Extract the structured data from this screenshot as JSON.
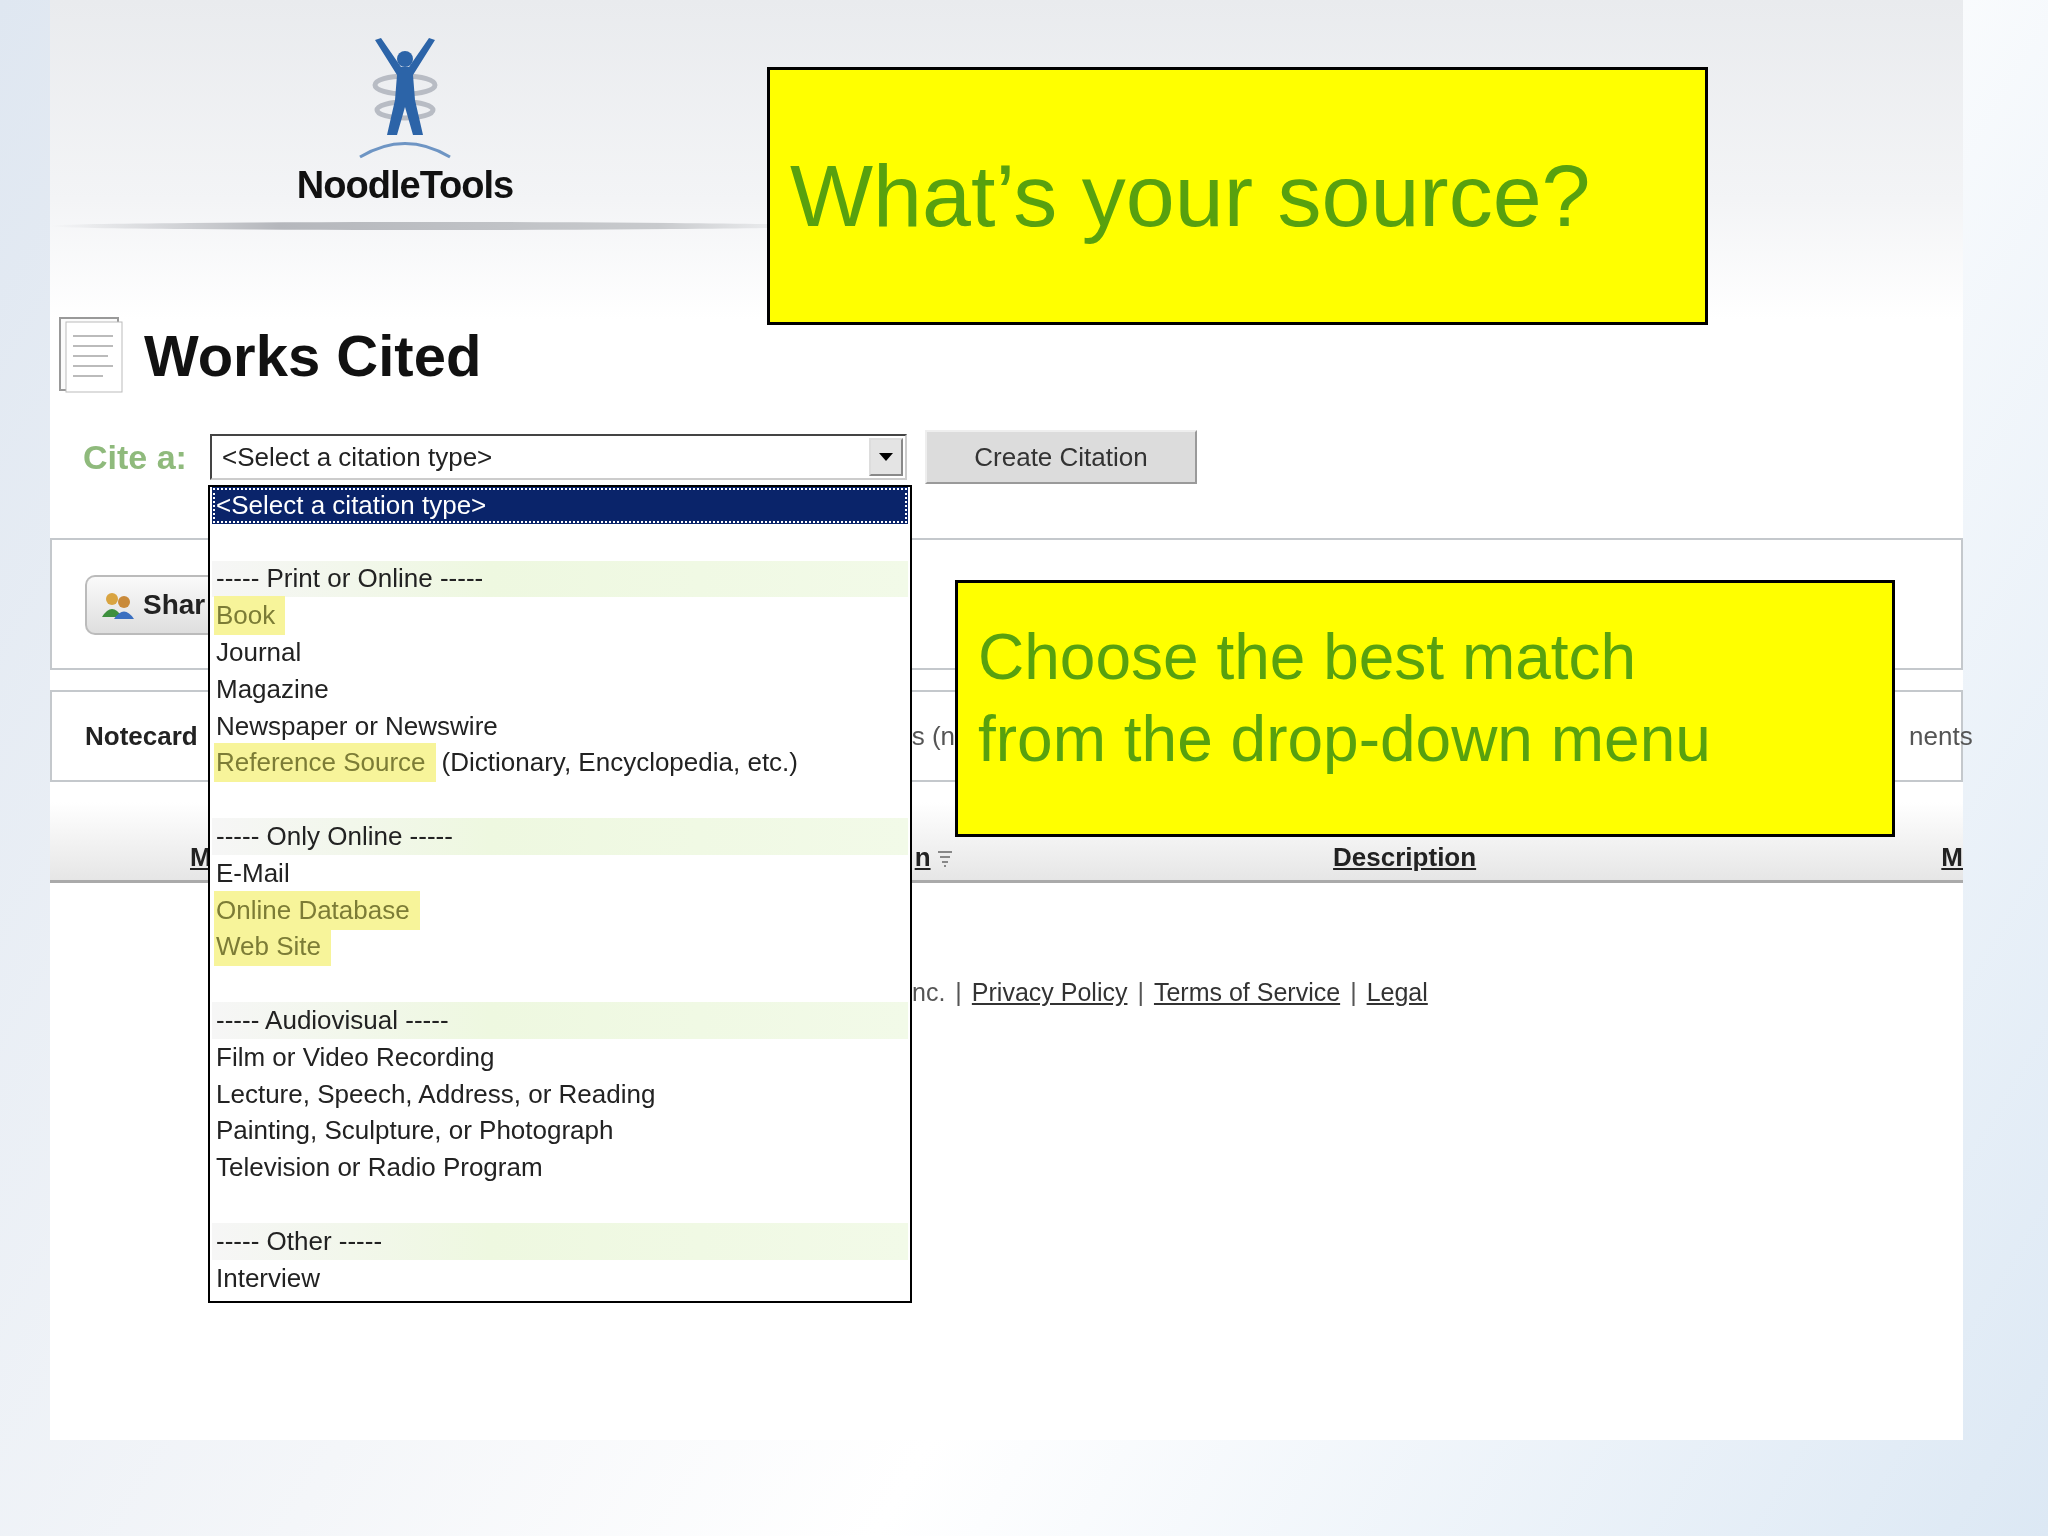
{
  "header": {
    "logo_text": "NoodleTools"
  },
  "page_title": "Works Cited",
  "cite_form": {
    "label": "Cite a:",
    "select_value": "<Select a citation type>",
    "button": "Create Citation"
  },
  "citation_menu": {
    "options": [
      {
        "kind": "option",
        "label": "<Select a citation type>",
        "selected": true,
        "highlighted": false
      },
      {
        "kind": "blank"
      },
      {
        "kind": "group",
        "label": "----- Print or Online -----"
      },
      {
        "kind": "option",
        "label": "Book",
        "selected": false,
        "highlighted": true
      },
      {
        "kind": "option",
        "label": "Journal",
        "selected": false,
        "highlighted": false
      },
      {
        "kind": "option",
        "label": "Magazine",
        "selected": false,
        "highlighted": false
      },
      {
        "kind": "option",
        "label": "Newspaper or Newswire",
        "selected": false,
        "highlighted": false
      },
      {
        "kind": "option",
        "label": "Reference Source",
        "note": "(Dictionary, Encyclopedia, etc.)",
        "selected": false,
        "highlighted": true
      },
      {
        "kind": "blank"
      },
      {
        "kind": "group",
        "label": "----- Only Online -----"
      },
      {
        "kind": "option",
        "label": "E-Mail",
        "selected": false,
        "highlighted": false
      },
      {
        "kind": "option",
        "label": "Online Database",
        "selected": false,
        "highlighted": true
      },
      {
        "kind": "option",
        "label": "Web Site",
        "selected": false,
        "highlighted": true
      },
      {
        "kind": "blank"
      },
      {
        "kind": "group",
        "label": "----- Audiovisual -----"
      },
      {
        "kind": "option",
        "label": "Film or Video Recording",
        "selected": false,
        "highlighted": false
      },
      {
        "kind": "option",
        "label": "Lecture, Speech, Address, or Reading",
        "selected": false,
        "highlighted": false
      },
      {
        "kind": "option",
        "label": "Painting, Sculpture, or Photograph",
        "selected": false,
        "highlighted": false
      },
      {
        "kind": "option",
        "label": "Television or Radio Program",
        "selected": false,
        "highlighted": false
      },
      {
        "kind": "blank"
      },
      {
        "kind": "group",
        "label": "----- Other -----"
      },
      {
        "kind": "option",
        "label": "Interview",
        "selected": false,
        "highlighted": false
      }
    ]
  },
  "share_button": "Shar",
  "tab_strip": [
    "Notecard",
    "s (n",
    "nents"
  ],
  "table": {
    "columns": [
      {
        "label": "M",
        "filter": false
      },
      {
        "label": "n",
        "filter": true
      },
      {
        "label": "Description",
        "filter": false
      },
      {
        "label": "M",
        "filter": false
      }
    ]
  },
  "footer": {
    "text": "nc.",
    "separator": "|",
    "links": [
      "Privacy Policy",
      "Terms of Service",
      "Legal"
    ]
  },
  "callouts": [
    {
      "lines": [
        "What’s your source?"
      ]
    },
    {
      "lines": [
        "Choose the best match",
        "from the drop-down menu"
      ]
    }
  ]
}
